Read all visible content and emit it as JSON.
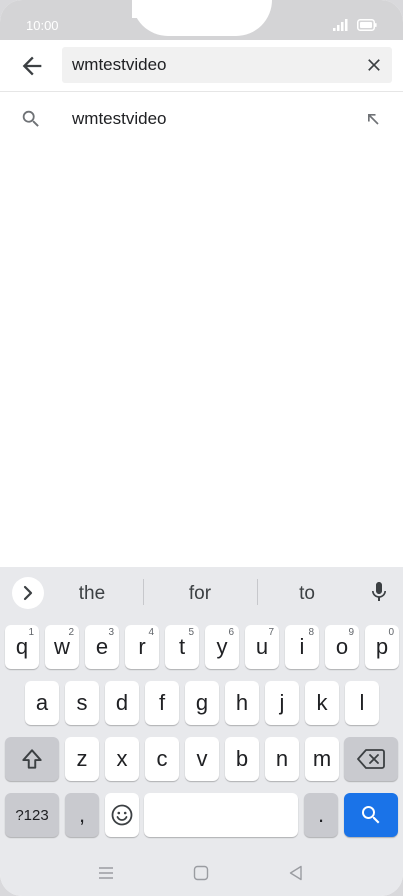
{
  "status": {
    "time": "10:00"
  },
  "search": {
    "query": "wmtestvideo"
  },
  "suggestions": [
    {
      "text": "wmtestvideo"
    }
  ],
  "keyboard": {
    "word_suggestions": [
      "the",
      "for",
      "to"
    ],
    "row1": [
      {
        "k": "q",
        "h": "1"
      },
      {
        "k": "w",
        "h": "2"
      },
      {
        "k": "e",
        "h": "3"
      },
      {
        "k": "r",
        "h": "4"
      },
      {
        "k": "t",
        "h": "5"
      },
      {
        "k": "y",
        "h": "6"
      },
      {
        "k": "u",
        "h": "7"
      },
      {
        "k": "i",
        "h": "8"
      },
      {
        "k": "o",
        "h": "9"
      },
      {
        "k": "p",
        "h": "0"
      }
    ],
    "row2": [
      "a",
      "s",
      "d",
      "f",
      "g",
      "h",
      "j",
      "k",
      "l"
    ],
    "row3": [
      "z",
      "x",
      "c",
      "v",
      "b",
      "n",
      "m"
    ],
    "symbols_label": "?123",
    "comma_label": ",",
    "period_label": "."
  },
  "colors": {
    "accent": "#1a73e8",
    "keyboard_bg": "#e8e9ec"
  }
}
